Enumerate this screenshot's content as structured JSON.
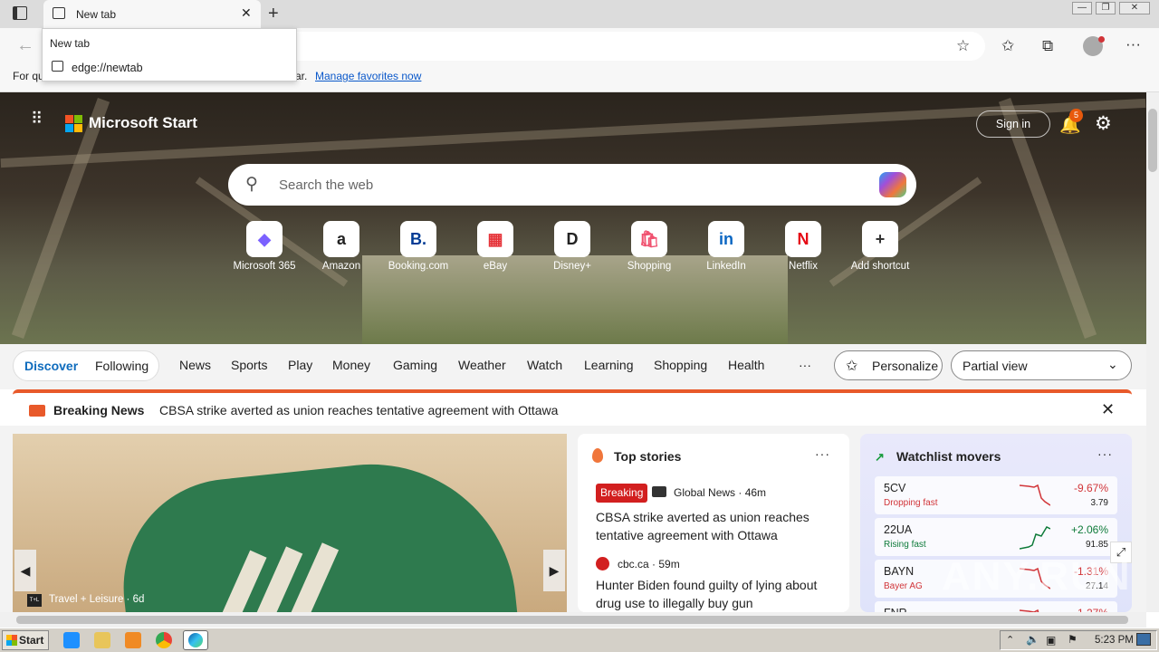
{
  "browser": {
    "tab_title": "New tab",
    "favorites_bar_text": "For qu",
    "favorites_bar_text_2": "ar.",
    "favorites_link": "Manage favorites now",
    "dropdown": {
      "title": "New tab",
      "url": "edge://newtab"
    }
  },
  "header": {
    "brand": "Microsoft Start",
    "sign_in": "Sign in",
    "notification_count": "5"
  },
  "search": {
    "placeholder": "Search the web"
  },
  "shortcuts": [
    {
      "label": "Microsoft 365",
      "icon": "m365-icon",
      "glyph": "◆",
      "color": "#7b61ff"
    },
    {
      "label": "Amazon",
      "icon": "amazon-icon",
      "glyph": "a",
      "color": "#222"
    },
    {
      "label": "Booking.com",
      "icon": "booking-icon",
      "glyph": "B.",
      "color": "#003b95"
    },
    {
      "label": "eBay",
      "icon": "ebay-icon",
      "glyph": "▦",
      "color": "#e53238"
    },
    {
      "label": "Disney+",
      "icon": "disney-icon",
      "glyph": "D",
      "color": "#222"
    },
    {
      "label": "Shopping",
      "icon": "shopping-bag-icon",
      "glyph": "🛍",
      "color": "#f0506e"
    },
    {
      "label": "LinkedIn",
      "icon": "linkedin-icon",
      "glyph": "in",
      "color": "#0a66c2"
    },
    {
      "label": "Netflix",
      "icon": "netflix-icon",
      "glyph": "N",
      "color": "#e50914"
    },
    {
      "label": "Add shortcut",
      "icon": "plus-icon",
      "glyph": "+",
      "color": "#333"
    }
  ],
  "nav": {
    "pills": [
      "Discover",
      "Following"
    ],
    "items": [
      "News",
      "Sports",
      "Play",
      "Money",
      "Gaming",
      "Weather",
      "Watch",
      "Learning",
      "Shopping",
      "Health"
    ],
    "more": "···",
    "personalize": "Personalize",
    "view": "Partial view"
  },
  "breaking": {
    "label": "Breaking News",
    "text": "CBSA strike averted as union reaches tentative agreement with Ottawa"
  },
  "feature": {
    "source": "Travel + Leisure · 6d"
  },
  "top_stories": {
    "title": "Top stories",
    "stories": [
      {
        "badge": "Breaking",
        "source": "Global News · 46m",
        "headline": "CBSA strike averted as union reaches tentative agreement with Ottawa"
      },
      {
        "source": "cbc.ca · 59m",
        "headline": "Hunter Biden found guilty of lying about drug use to illegally buy gun"
      }
    ]
  },
  "watchlist": {
    "title": "Watchlist movers",
    "stocks": [
      {
        "symbol": "5CV",
        "sub": "Dropping fast",
        "change": "-9.67%",
        "price": "3.79",
        "color": "#d13438"
      },
      {
        "symbol": "22UA",
        "sub": "Rising fast",
        "change": "+2.06%",
        "price": "91.85",
        "color": "#0f7b3a"
      },
      {
        "symbol": "BAYN",
        "sub": "Bayer AG",
        "change": "-1.31%",
        "price": "27.14",
        "color": "#d13438"
      },
      {
        "symbol": "FNR",
        "sub": "",
        "change": "-1.27%",
        "price": "",
        "color": "#d13438"
      }
    ]
  },
  "watermark": "ANY.RUN",
  "taskbar": {
    "start": "Start",
    "clock": "5:23 PM"
  }
}
